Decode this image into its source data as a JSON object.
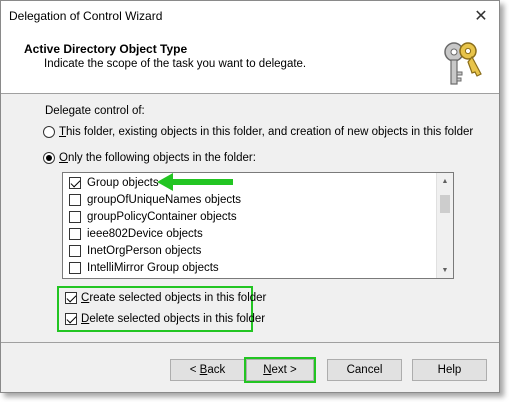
{
  "window": {
    "title": "Delegation of Control Wizard"
  },
  "header": {
    "title": "Active Directory Object Type",
    "subtitle": "Indicate the scope of the task you want to delegate."
  },
  "delegate": {
    "label": "Delegate control of:",
    "radio_all": {
      "mnemonic": "T",
      "rest": "his folder, existing objects in this folder, and creation of new objects in this folder",
      "checked": false
    },
    "radio_only": {
      "mnemonic": "O",
      "rest": "nly the following objects in the folder:",
      "checked": true
    }
  },
  "object_list": {
    "items": [
      {
        "label": "Group objects",
        "checked": true
      },
      {
        "label": "groupOfUniqueNames objects",
        "checked": false
      },
      {
        "label": "groupPolicyContainer objects",
        "checked": false
      },
      {
        "label": "ieee802Device objects",
        "checked": false
      },
      {
        "label": "InetOrgPerson objects",
        "checked": false
      },
      {
        "label": "IntelliMirror Group objects",
        "checked": false
      }
    ]
  },
  "options": {
    "create": {
      "mnemonic": "C",
      "rest": "reate selected objects in this folder",
      "checked": true
    },
    "delete": {
      "mnemonic": "D",
      "rest": "elete selected objects in this folder",
      "checked": true
    }
  },
  "buttons": {
    "back": {
      "prefix": "< ",
      "mnemonic": "B",
      "rest": "ack"
    },
    "next": {
      "mnemonic": "N",
      "rest": "ext >"
    },
    "cancel": "Cancel",
    "help": "Help"
  },
  "annotation_color": "#22c522",
  "icons": {
    "header": "keys-icon",
    "close": "close-icon"
  }
}
